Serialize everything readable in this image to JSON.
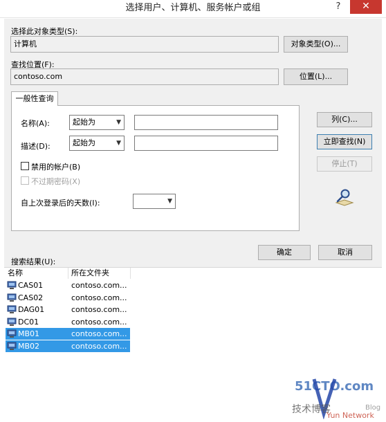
{
  "window": {
    "title": "选择用户、计算机、服务帐户或组",
    "help_label": "?",
    "close_label": "✕"
  },
  "object_type": {
    "label": "选择此对象类型(S):",
    "value": "计算机",
    "button": "对象类型(O)..."
  },
  "location": {
    "label": "查找位置(F):",
    "value": "contoso.com",
    "button": "位置(L)..."
  },
  "tab": {
    "label": "一般性查询"
  },
  "query": {
    "name_label": "名称(A):",
    "name_mode": "起始为",
    "name_value": "",
    "desc_label": "描述(D):",
    "desc_mode": "起始为",
    "desc_value": "",
    "disabled_accounts": "禁用的帐户(B)",
    "non_expiring": "不过期密码(X)",
    "days_label": "自上次登录后的天数(I):",
    "days_value": ""
  },
  "side_buttons": {
    "columns": "列(C)...",
    "find_now": "立即查找(N)",
    "stop": "停止(T)"
  },
  "footer": {
    "ok": "确定",
    "cancel": "取消",
    "results_label": "搜索结果(U):"
  },
  "results": {
    "headers": [
      "名称",
      "所在文件夹"
    ],
    "rows": [
      {
        "name": "CAS01",
        "folder": "contoso.com...",
        "selected": false
      },
      {
        "name": "CAS02",
        "folder": "contoso.com...",
        "selected": false
      },
      {
        "name": "DAG01",
        "folder": "contoso.com...",
        "selected": false
      },
      {
        "name": "DC01",
        "folder": "contoso.com...",
        "selected": false
      },
      {
        "name": "MB01",
        "folder": "contoso.com...",
        "selected": true
      },
      {
        "name": "MB02",
        "folder": "contoso.com...",
        "selected": true
      }
    ]
  },
  "watermark": {
    "line1": "51CTO.com",
    "line2": "技术博客",
    "line3": "Blog",
    "line4": "Yun Network"
  },
  "colors": {
    "selection": "#3399e6",
    "close": "#c7372f",
    "default_border": "#3c7fb1"
  },
  "icons": {
    "computer": "computer-icon",
    "search": "search-binoculars-icon"
  }
}
